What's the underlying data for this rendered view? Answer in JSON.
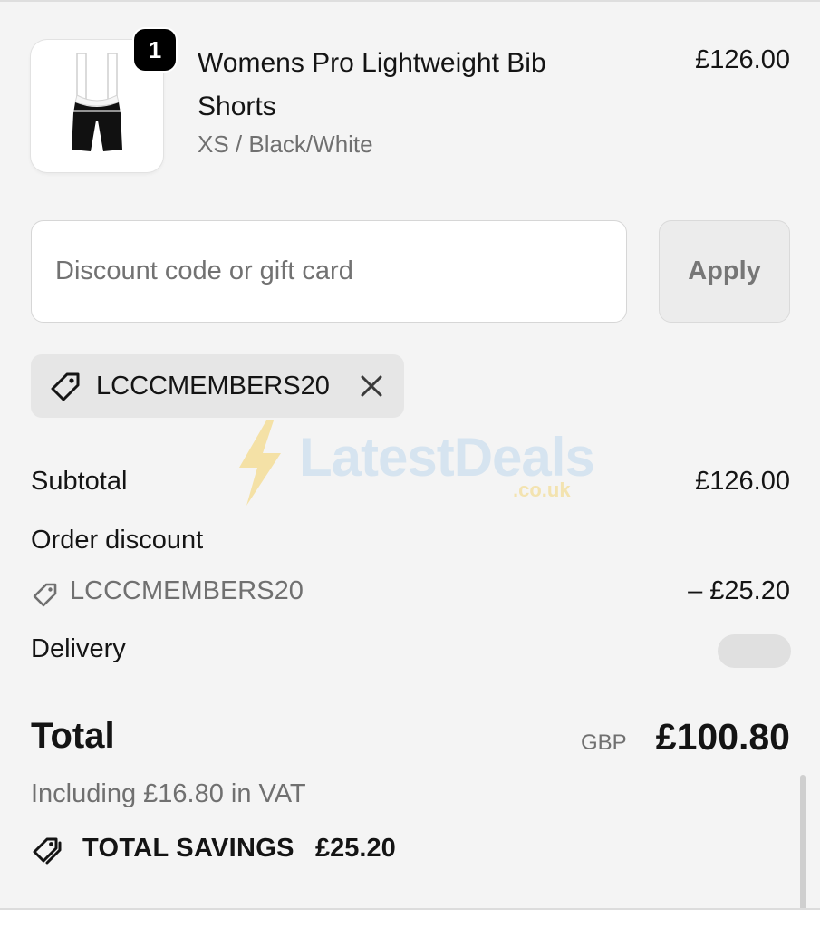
{
  "product": {
    "quantity": "1",
    "name": "Womens Pro Lightweight Bib Shorts",
    "variant": "XS / Black/White",
    "price": "£126.00",
    "thumbnail_icon": "bib-shorts-image"
  },
  "discount": {
    "placeholder": "Discount code or gift card",
    "value": "",
    "apply_label": "Apply",
    "applied_code": "LCCCMEMBERS20"
  },
  "watermark": {
    "brand": "LatestDeals",
    "domain": ".co.uk"
  },
  "summary": {
    "subtotal_label": "Subtotal",
    "subtotal_value": "£126.00",
    "order_discount_label": "Order discount",
    "discount_code": "LCCCMEMBERS20",
    "discount_value": "– £25.20",
    "delivery_label": "Delivery",
    "total_label": "Total",
    "currency": "GBP",
    "total_value": "£100.80",
    "vat_note": "Including £16.80 in VAT",
    "savings_label": "TOTAL SAVINGS",
    "savings_value": "£25.20"
  },
  "colors": {
    "background": "#f4f4f4",
    "text": "#141414",
    "muted_text": "#707070",
    "badge": "#000000"
  }
}
